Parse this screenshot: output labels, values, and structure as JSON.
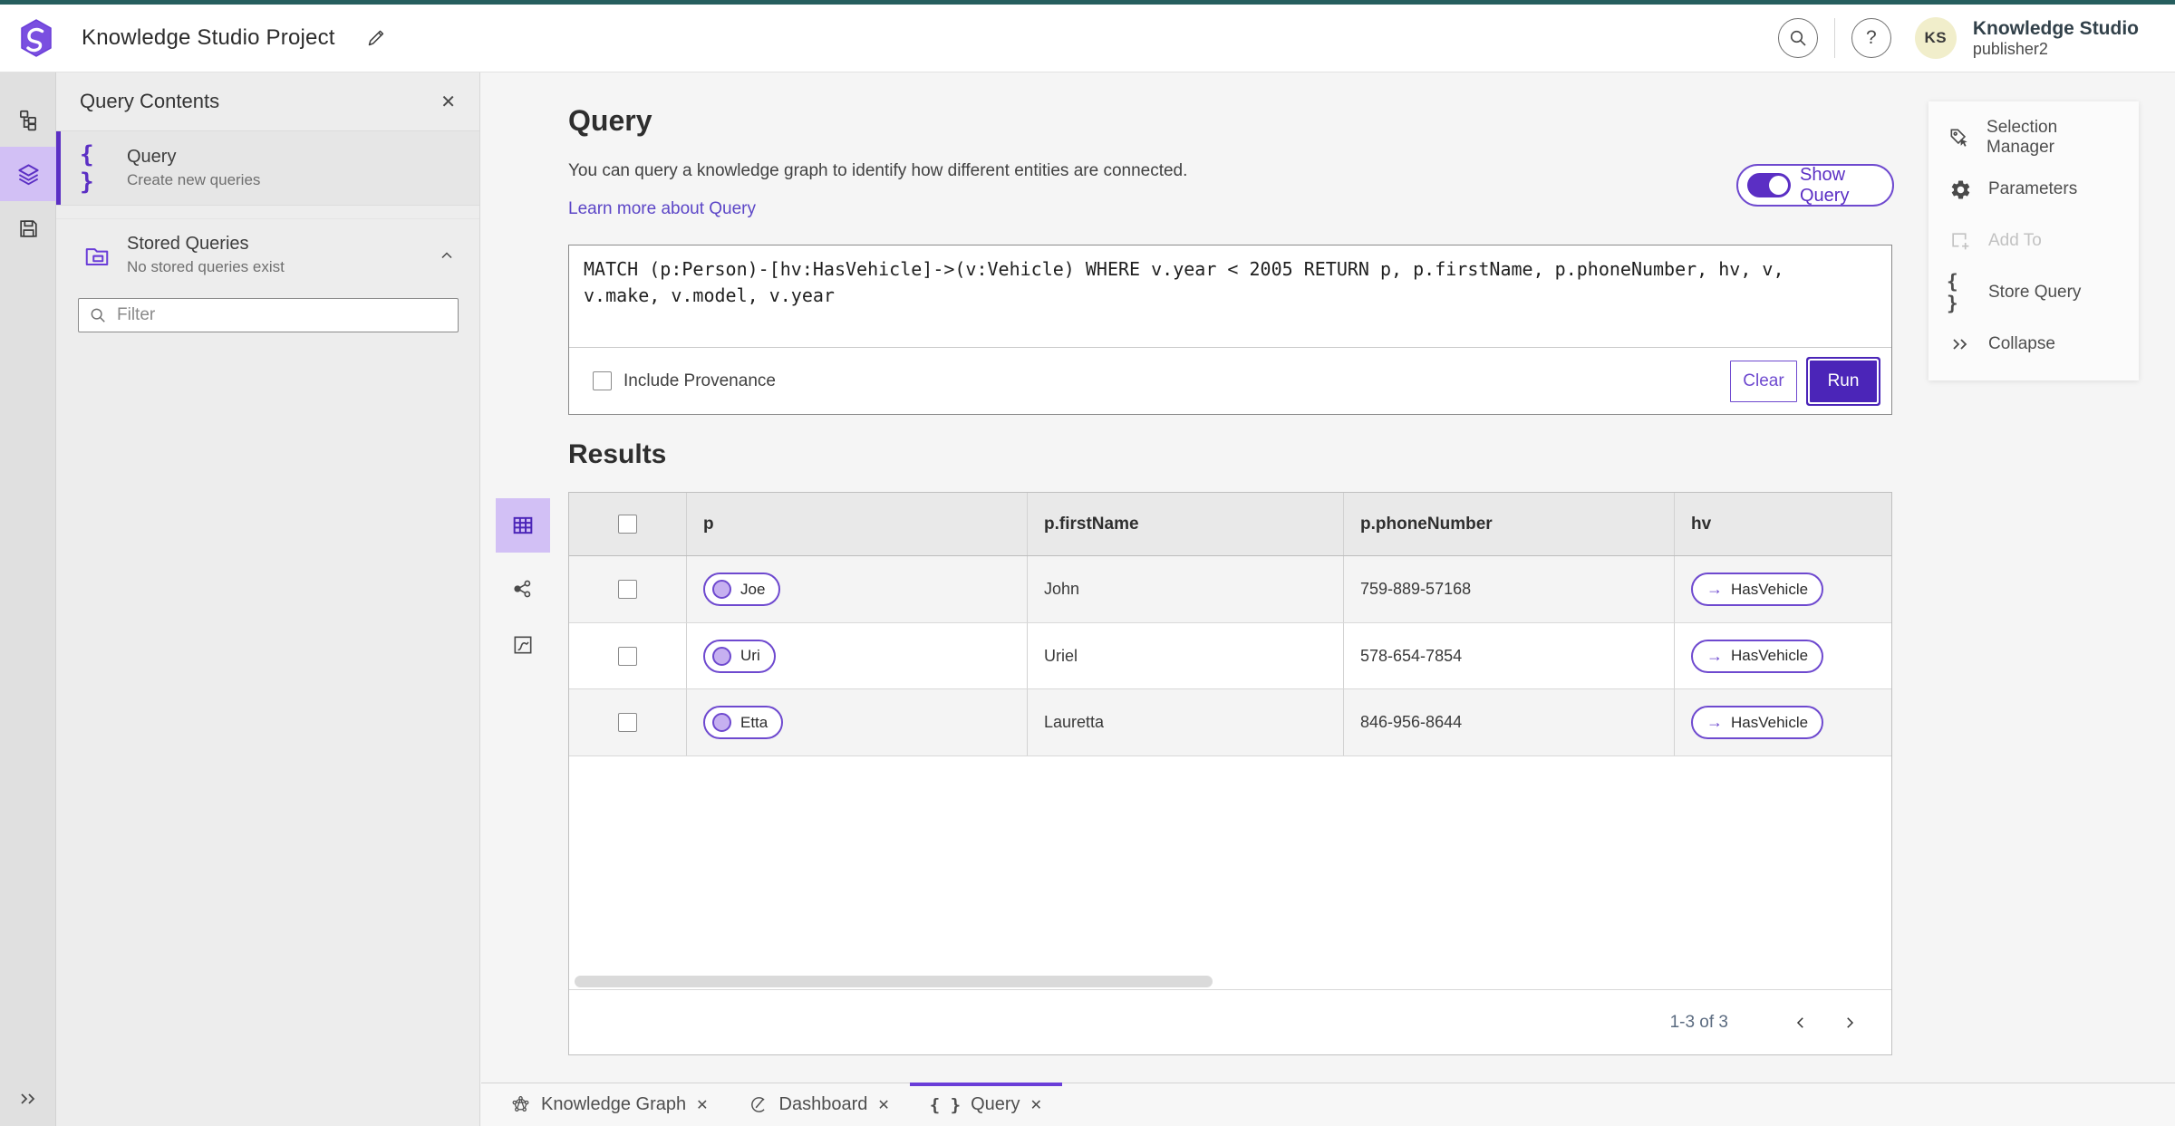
{
  "header": {
    "app_title": "Knowledge Studio Project",
    "product_name": "Knowledge Studio",
    "user_name": "publisher2",
    "avatar_initials": "KS"
  },
  "contents_panel": {
    "title": "Query Contents",
    "query_item": {
      "label": "Query",
      "description": "Create new queries"
    },
    "stored_item": {
      "label": "Stored Queries",
      "description": "No stored queries exist"
    },
    "filter_placeholder": "Filter"
  },
  "query_section": {
    "heading": "Query",
    "description": "You can query a knowledge graph to identify how different entities are connected.",
    "learn_more_link": "Learn more about Query",
    "show_query_label": "Show Query",
    "query_text": "MATCH (p:Person)-[hv:HasVehicle]->(v:Vehicle) WHERE v.year < 2005 RETURN p, p.firstName, p.phoneNumber, hv, v, v.make, v.model, v.year",
    "include_provenance_label": "Include Provenance",
    "clear_button": "Clear",
    "run_button": "Run"
  },
  "results": {
    "heading": "Results",
    "columns": [
      "p",
      "p.firstName",
      "p.phoneNumber",
      "hv"
    ],
    "rows": [
      {
        "p": "Joe",
        "firstName": "John",
        "phone": "759-889-57168",
        "hv": "HasVehicle",
        "arrow": "→"
      },
      {
        "p": "Uri",
        "firstName": "Uriel",
        "phone": "578-654-7854",
        "hv": "HasVehicle",
        "arrow": "→"
      },
      {
        "p": "Etta",
        "firstName": "Lauretta",
        "phone": "846-956-8644",
        "hv": "HasVehicle",
        "arrow": "→"
      }
    ],
    "pagination": "1-3 of 3"
  },
  "actions_panel": {
    "items": [
      {
        "label": "Selection Manager",
        "disabled": false
      },
      {
        "label": "Parameters",
        "disabled": false
      },
      {
        "label": "Add To",
        "disabled": true
      },
      {
        "label": "Store Query",
        "disabled": false
      },
      {
        "label": "Collapse",
        "disabled": false
      }
    ]
  },
  "tabs": [
    {
      "label": "Knowledge Graph",
      "active": false
    },
    {
      "label": "Dashboard",
      "active": false
    },
    {
      "label": "Query",
      "active": true
    }
  ],
  "icons": {
    "braces": "{ }",
    "collapse_glyph": "»"
  },
  "colors": {
    "accent_purple": "#4b25b8",
    "purple_border": "#6e49cf",
    "lavender": "#d2c0f5",
    "teal_top": "#265e5e",
    "link": "#5c46c7",
    "avatar_bg": "#f1eecb"
  }
}
